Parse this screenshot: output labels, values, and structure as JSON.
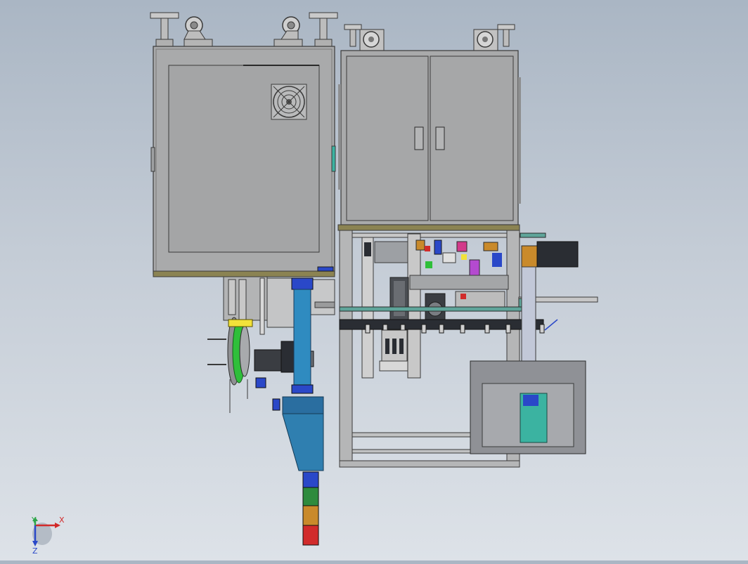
{
  "viewport": {
    "background_top": "#aab6c4",
    "background_bottom": "#dde2e8"
  },
  "model": {
    "colors": {
      "cabinet_gray": "#a9aaab",
      "frame_gray": "#b5b6b7",
      "edge_dark": "#3a3a3a",
      "base_olive": "#8b8352",
      "tower_blue": "#2f8bc0",
      "accent_green": "#2fbf3a",
      "accent_yellow": "#f2e23a",
      "accent_teal": "#3bb3a1",
      "stack_green": "#2e8b3d",
      "stack_amber": "#c98a2b",
      "stack_red": "#d12b2b",
      "conveyor_teal": "#5fa59a",
      "rail_dark": "#2a2d33"
    },
    "icons": [
      "fan-grille-icon",
      "caster-wheel-icon",
      "leveling-foot-icon",
      "signal-light-tower-icon"
    ]
  },
  "triad": {
    "x_label": "X",
    "y_label": "Y",
    "z_label": "Z",
    "x_color": "#d22a2a",
    "y_color": "#2fa64a",
    "z_color": "#2a48c8"
  }
}
